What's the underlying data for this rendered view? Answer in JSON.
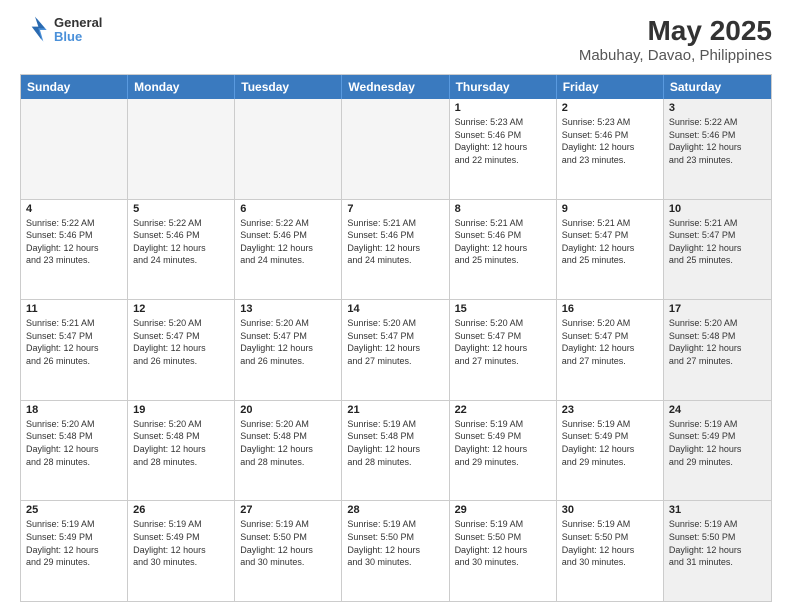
{
  "header": {
    "logo": {
      "line1": "General",
      "line2": "Blue"
    },
    "title": "May 2025",
    "subtitle": "Mabuhay, Davao, Philippines"
  },
  "weekdays": [
    "Sunday",
    "Monday",
    "Tuesday",
    "Wednesday",
    "Thursday",
    "Friday",
    "Saturday"
  ],
  "rows": [
    [
      {
        "day": "",
        "text": "",
        "empty": true
      },
      {
        "day": "",
        "text": "",
        "empty": true
      },
      {
        "day": "",
        "text": "",
        "empty": true
      },
      {
        "day": "",
        "text": "",
        "empty": true
      },
      {
        "day": "1",
        "text": "Sunrise: 5:23 AM\nSunset: 5:46 PM\nDaylight: 12 hours\nand 22 minutes."
      },
      {
        "day": "2",
        "text": "Sunrise: 5:23 AM\nSunset: 5:46 PM\nDaylight: 12 hours\nand 23 minutes."
      },
      {
        "day": "3",
        "text": "Sunrise: 5:22 AM\nSunset: 5:46 PM\nDaylight: 12 hours\nand 23 minutes.",
        "shaded": true
      }
    ],
    [
      {
        "day": "4",
        "text": "Sunrise: 5:22 AM\nSunset: 5:46 PM\nDaylight: 12 hours\nand 23 minutes."
      },
      {
        "day": "5",
        "text": "Sunrise: 5:22 AM\nSunset: 5:46 PM\nDaylight: 12 hours\nand 24 minutes."
      },
      {
        "day": "6",
        "text": "Sunrise: 5:22 AM\nSunset: 5:46 PM\nDaylight: 12 hours\nand 24 minutes."
      },
      {
        "day": "7",
        "text": "Sunrise: 5:21 AM\nSunset: 5:46 PM\nDaylight: 12 hours\nand 24 minutes."
      },
      {
        "day": "8",
        "text": "Sunrise: 5:21 AM\nSunset: 5:46 PM\nDaylight: 12 hours\nand 25 minutes."
      },
      {
        "day": "9",
        "text": "Sunrise: 5:21 AM\nSunset: 5:47 PM\nDaylight: 12 hours\nand 25 minutes."
      },
      {
        "day": "10",
        "text": "Sunrise: 5:21 AM\nSunset: 5:47 PM\nDaylight: 12 hours\nand 25 minutes.",
        "shaded": true
      }
    ],
    [
      {
        "day": "11",
        "text": "Sunrise: 5:21 AM\nSunset: 5:47 PM\nDaylight: 12 hours\nand 26 minutes."
      },
      {
        "day": "12",
        "text": "Sunrise: 5:20 AM\nSunset: 5:47 PM\nDaylight: 12 hours\nand 26 minutes."
      },
      {
        "day": "13",
        "text": "Sunrise: 5:20 AM\nSunset: 5:47 PM\nDaylight: 12 hours\nand 26 minutes."
      },
      {
        "day": "14",
        "text": "Sunrise: 5:20 AM\nSunset: 5:47 PM\nDaylight: 12 hours\nand 27 minutes."
      },
      {
        "day": "15",
        "text": "Sunrise: 5:20 AM\nSunset: 5:47 PM\nDaylight: 12 hours\nand 27 minutes."
      },
      {
        "day": "16",
        "text": "Sunrise: 5:20 AM\nSunset: 5:47 PM\nDaylight: 12 hours\nand 27 minutes."
      },
      {
        "day": "17",
        "text": "Sunrise: 5:20 AM\nSunset: 5:48 PM\nDaylight: 12 hours\nand 27 minutes.",
        "shaded": true
      }
    ],
    [
      {
        "day": "18",
        "text": "Sunrise: 5:20 AM\nSunset: 5:48 PM\nDaylight: 12 hours\nand 28 minutes."
      },
      {
        "day": "19",
        "text": "Sunrise: 5:20 AM\nSunset: 5:48 PM\nDaylight: 12 hours\nand 28 minutes."
      },
      {
        "day": "20",
        "text": "Sunrise: 5:20 AM\nSunset: 5:48 PM\nDaylight: 12 hours\nand 28 minutes."
      },
      {
        "day": "21",
        "text": "Sunrise: 5:19 AM\nSunset: 5:48 PM\nDaylight: 12 hours\nand 28 minutes."
      },
      {
        "day": "22",
        "text": "Sunrise: 5:19 AM\nSunset: 5:49 PM\nDaylight: 12 hours\nand 29 minutes."
      },
      {
        "day": "23",
        "text": "Sunrise: 5:19 AM\nSunset: 5:49 PM\nDaylight: 12 hours\nand 29 minutes."
      },
      {
        "day": "24",
        "text": "Sunrise: 5:19 AM\nSunset: 5:49 PM\nDaylight: 12 hours\nand 29 minutes.",
        "shaded": true
      }
    ],
    [
      {
        "day": "25",
        "text": "Sunrise: 5:19 AM\nSunset: 5:49 PM\nDaylight: 12 hours\nand 29 minutes."
      },
      {
        "day": "26",
        "text": "Sunrise: 5:19 AM\nSunset: 5:49 PM\nDaylight: 12 hours\nand 30 minutes."
      },
      {
        "day": "27",
        "text": "Sunrise: 5:19 AM\nSunset: 5:50 PM\nDaylight: 12 hours\nand 30 minutes."
      },
      {
        "day": "28",
        "text": "Sunrise: 5:19 AM\nSunset: 5:50 PM\nDaylight: 12 hours\nand 30 minutes."
      },
      {
        "day": "29",
        "text": "Sunrise: 5:19 AM\nSunset: 5:50 PM\nDaylight: 12 hours\nand 30 minutes."
      },
      {
        "day": "30",
        "text": "Sunrise: 5:19 AM\nSunset: 5:50 PM\nDaylight: 12 hours\nand 30 minutes."
      },
      {
        "day": "31",
        "text": "Sunrise: 5:19 AM\nSunset: 5:50 PM\nDaylight: 12 hours\nand 31 minutes.",
        "shaded": true
      }
    ]
  ]
}
